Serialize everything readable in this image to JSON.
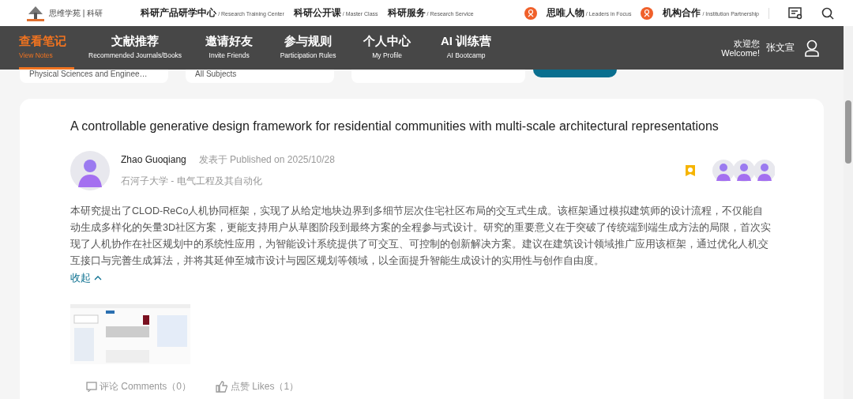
{
  "top_bar": {
    "logo_text": "思维学苑 | 科研",
    "links": [
      {
        "title": "科研产品研学中心",
        "subtitle": "/ Research Training Center"
      },
      {
        "title": "科研公开课",
        "subtitle": "/ Master Class"
      },
      {
        "title": "科研服务",
        "subtitle": "/ Research Service"
      }
    ],
    "features": [
      {
        "title": "思唯人物",
        "subtitle": "/ Leaders in Focus"
      },
      {
        "title": "机构合作",
        "subtitle": "/ Institution Partnership"
      }
    ]
  },
  "nav": {
    "tabs": [
      {
        "title": "查看笔记",
        "subtitle": "View Notes",
        "selected": true
      },
      {
        "title": "文献推荐",
        "subtitle": "Recommended Journals/Books",
        "selected": false
      },
      {
        "title": "邀请好友",
        "subtitle": "Invite Friends",
        "selected": false
      },
      {
        "title": "参与规则",
        "subtitle": "Participation Rules",
        "selected": false
      },
      {
        "title": "个人中心",
        "subtitle": "My Profile",
        "selected": false
      },
      {
        "title": "AI 训练营",
        "subtitle": "AI Bootcamp",
        "selected": false
      }
    ],
    "welcome": "欢迎您",
    "welcome_en": "Welcome!",
    "user_name": "张文宣"
  },
  "filters": [
    {
      "subtitle": "Physical Sciences and Enginee…"
    },
    {
      "subtitle": "All Subjects"
    }
  ],
  "note": {
    "title": "A controllable generative design framework for residential communities with multi-scale architectural representations",
    "author": "Zhao Guoqiang",
    "published": "发表于 Published on 2025/10/28",
    "affiliation": "石河子大学 - 电气工程及其自动化",
    "abstract": "本研究提出了CLOD-ReCo人机协同框架，实现了从给定地块边界到多细节层次住宅社区布局的交互式生成。该框架通过模拟建筑师的设计流程，不仅能自动生成多样化的矢量3D社区方案，更能支持用户从草图阶段到最终方案的全程参与式设计。研究的重要意义在于突破了传统端到端生成方法的局限，首次实现了人机协作在社区规划中的系统性应用，为智能设计系统提供了可交互、可控制的创新解决方案。建议在建筑设计领域推广应用该框架，通过优化人机交互接口与完善生成算法，并将其延伸至城市设计与园区规划等领域，以全面提升智能生成设计的实用性与创作自由度。",
    "collapse": "收起",
    "comments": "评论 Comments（0）",
    "likes": "点赞 Likes（1）"
  }
}
